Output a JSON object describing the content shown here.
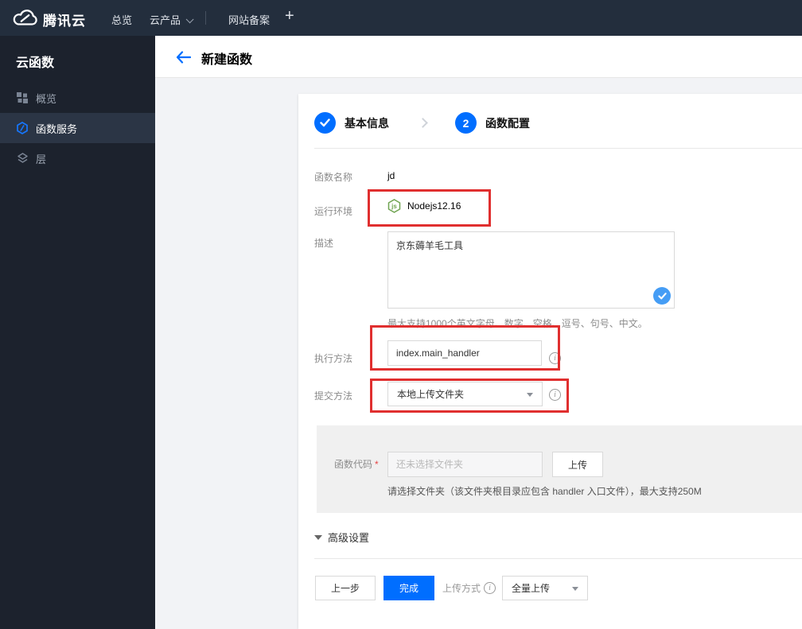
{
  "colors": {
    "accent_blue": "#006eff",
    "annotation_red": "#e02f2f",
    "check_bubble_blue": "#459df5",
    "navbar_bg": "#232e3d",
    "sidebar_bg": "#1c222d",
    "nodejs_green": "#6fa350"
  },
  "icons": {
    "info": "i",
    "nodejs_letters": "js"
  },
  "navbar": {
    "brand": "腾讯云",
    "items": [
      {
        "label": "总览"
      },
      {
        "label": "云产品"
      },
      {
        "label": "网站备案"
      }
    ],
    "plus_label": "+"
  },
  "sidebar": {
    "title": "云函数",
    "items": [
      {
        "label": "概览"
      },
      {
        "label": "函数服务"
      },
      {
        "label": "层"
      }
    ]
  },
  "header": {
    "title": "新建函数"
  },
  "steps": {
    "step1": {
      "label": "基本信息"
    },
    "step2": {
      "number": "2",
      "label": "函数配置"
    }
  },
  "form": {
    "name_label": "函数名称",
    "name_value": "jd",
    "runtime_label": "运行环境",
    "runtime_value": "Nodejs12.16",
    "desc_label": "描述",
    "desc_value": "京东薅羊毛工具",
    "desc_hint": "最大支持1000个英文字母、数字、空格、逗号、句号、中文。",
    "handler_label": "执行方法",
    "handler_value": "index.main_handler",
    "submit_label": "提交方法",
    "submit_value": "本地上传文件夹",
    "code_label": "函数代码",
    "code_required": "*",
    "code_placeholder": "还未选择文件夹",
    "upload_button": "上传",
    "code_hint": "请选择文件夹（该文件夹根目录应包含 handler 入口文件），最大支持250M",
    "advanced_label": "高级设置"
  },
  "footer": {
    "prev_button": "上一步",
    "finish_button": "完成",
    "upload_mode_label": "上传方式",
    "upload_mode_value": "全量上传"
  }
}
